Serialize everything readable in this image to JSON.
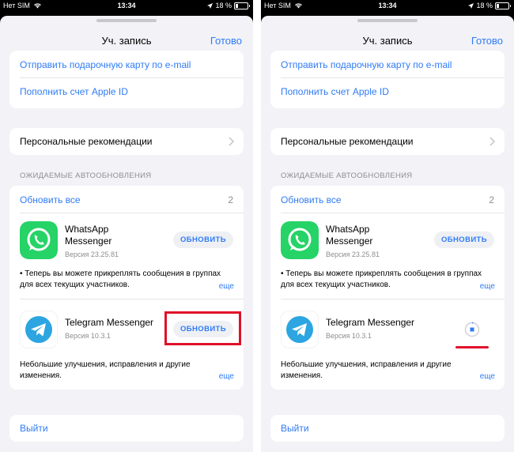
{
  "colors": {
    "accent": "#2f7bf6",
    "highlight": "#e0102a",
    "whatsapp": "#25d366",
    "telegram": "#2ca5e0"
  },
  "panels": [
    {
      "status": {
        "carrier": "Нет SIM",
        "time": "13:34",
        "battery": "18 %",
        "battery_level": 0.18
      },
      "nav": {
        "title": "Уч. запись",
        "done": "Готово"
      },
      "top_links": {
        "gift": "Отправить подарочную карту по e-mail",
        "topup": "Пополнить счет Apple ID"
      },
      "recommendations": "Персональные рекомендации",
      "section_header": "ОЖИДАЕМЫЕ АВТООБНОВЛЕНИЯ",
      "update_all": "Обновить все",
      "update_count": "2",
      "apps": [
        {
          "name_line1": "WhatsApp",
          "name_line2": "Messenger",
          "version": "Версия 23.25.81",
          "button": "ОБНОВИТЬ",
          "icon": "whatsapp-icon",
          "notes": "• Теперь вы можете прикреплять сообщения в группах для всех текущих участников.",
          "more": "еще"
        },
        {
          "name_line1": "Telegram Messenger",
          "version": "Версия 10.3.1",
          "button": "ОБНОВИТЬ",
          "icon": "telegram-icon",
          "notes": "Небольшие улучшения, исправления и другие изменения.",
          "more": "еще"
        }
      ],
      "signout": "Выйти"
    },
    {
      "status": {
        "carrier": "Нет SIM",
        "time": "13:34",
        "battery": "18 %",
        "battery_level": 0.18
      },
      "nav": {
        "title": "Уч. запись",
        "done": "Готово"
      },
      "top_links": {
        "gift": "Отправить подарочную карту по e-mail",
        "topup": "Пополнить счет Apple ID"
      },
      "recommendations": "Персональные рекомендации",
      "section_header": "ОЖИДАЕМЫЕ АВТООБНОВЛЕНИЯ",
      "update_all": "Обновить все",
      "update_count": "2",
      "apps": [
        {
          "name_line1": "WhatsApp",
          "name_line2": "Messenger",
          "version": "Версия 23.25.81",
          "button": "ОБНОВИТЬ",
          "icon": "whatsapp-icon",
          "notes": "• Теперь вы можете прикреплять сообщения в группах для всех текущих участников.",
          "more": "еще"
        },
        {
          "name_line1": "Telegram Messenger",
          "version": "Версия 10.3.1",
          "icon": "telegram-icon",
          "state": "downloading",
          "notes": "Небольшие улучшения, исправления и другие изменения.",
          "more": "еще"
        }
      ],
      "signout": "Выйти"
    }
  ]
}
